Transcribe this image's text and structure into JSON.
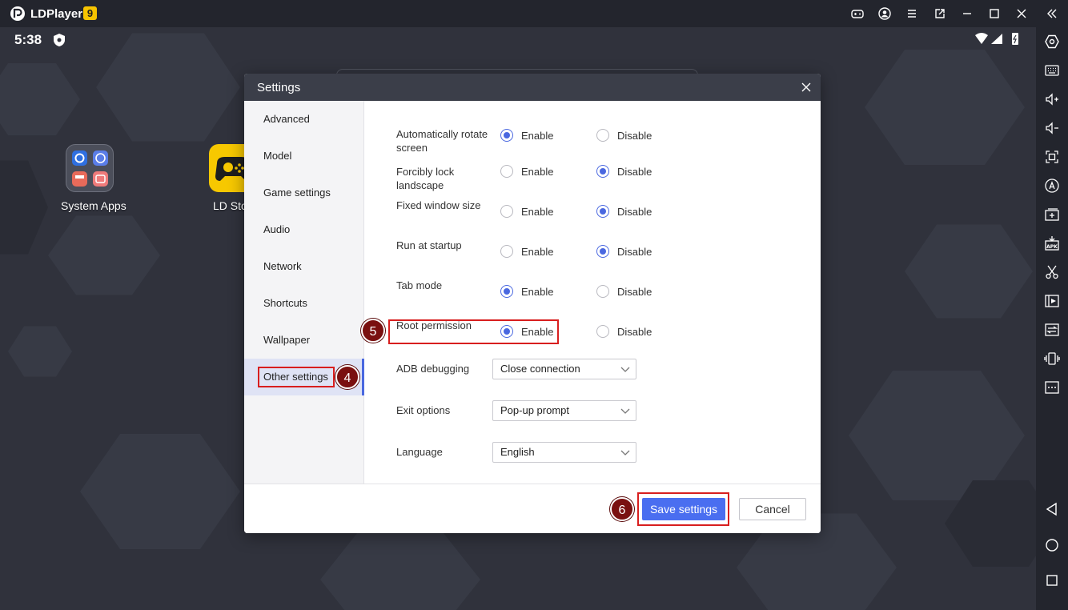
{
  "titlebar": {
    "app_name": "LDPlayer",
    "version_badge": "9",
    "buttons": [
      "gamepad-icon",
      "account-icon",
      "menu-icon",
      "popout-icon",
      "minimize-icon",
      "maximize-icon",
      "close-icon",
      "collapse-sidebar-icon"
    ]
  },
  "statusbar": {
    "time": "5:38"
  },
  "desktop": {
    "apps": [
      {
        "label": "System Apps"
      },
      {
        "label": "LD Store"
      }
    ]
  },
  "sidebar": {
    "icons": [
      "settings-hex-icon",
      "keyboard-icon",
      "volume-up-icon",
      "volume-down-icon",
      "fullscreen-icon",
      "auto-click-icon",
      "add-window-icon",
      "apk-icon",
      "scissors-icon",
      "record-icon",
      "sync-icon",
      "shake-icon",
      "more-icon",
      "back-icon",
      "home-icon",
      "recents-icon"
    ]
  },
  "dialog": {
    "title": "Settings",
    "nav": [
      {
        "label": "Advanced"
      },
      {
        "label": "Model"
      },
      {
        "label": "Game settings"
      },
      {
        "label": "Audio"
      },
      {
        "label": "Network"
      },
      {
        "label": "Shortcuts"
      },
      {
        "label": "Wallpaper"
      },
      {
        "label": "Other settings",
        "active": true
      }
    ],
    "enable_label": "Enable",
    "disable_label": "Disable",
    "options": [
      {
        "label": "Automatically rotate screen",
        "value": "Enable"
      },
      {
        "label": "Forcibly lock landscape",
        "value": "Disable"
      },
      {
        "label": "Fixed window size",
        "value": "Disable"
      },
      {
        "label": "Run at startup",
        "value": "Disable"
      },
      {
        "label": "Tab mode",
        "value": "Enable"
      },
      {
        "label": "Root permission",
        "value": "Enable"
      }
    ],
    "selects": [
      {
        "label": "ADB debugging",
        "value": "Close connection"
      },
      {
        "label": "Exit options",
        "value": "Pop-up prompt"
      },
      {
        "label": "Language",
        "value": "English"
      }
    ],
    "save_label": "Save settings",
    "cancel_label": "Cancel"
  },
  "steps": {
    "step4": "4",
    "step5": "5",
    "step6": "6"
  },
  "colors": {
    "accent": "#4a68e0",
    "highlight": "#d81e1e",
    "step_badge": "#7a1010"
  }
}
